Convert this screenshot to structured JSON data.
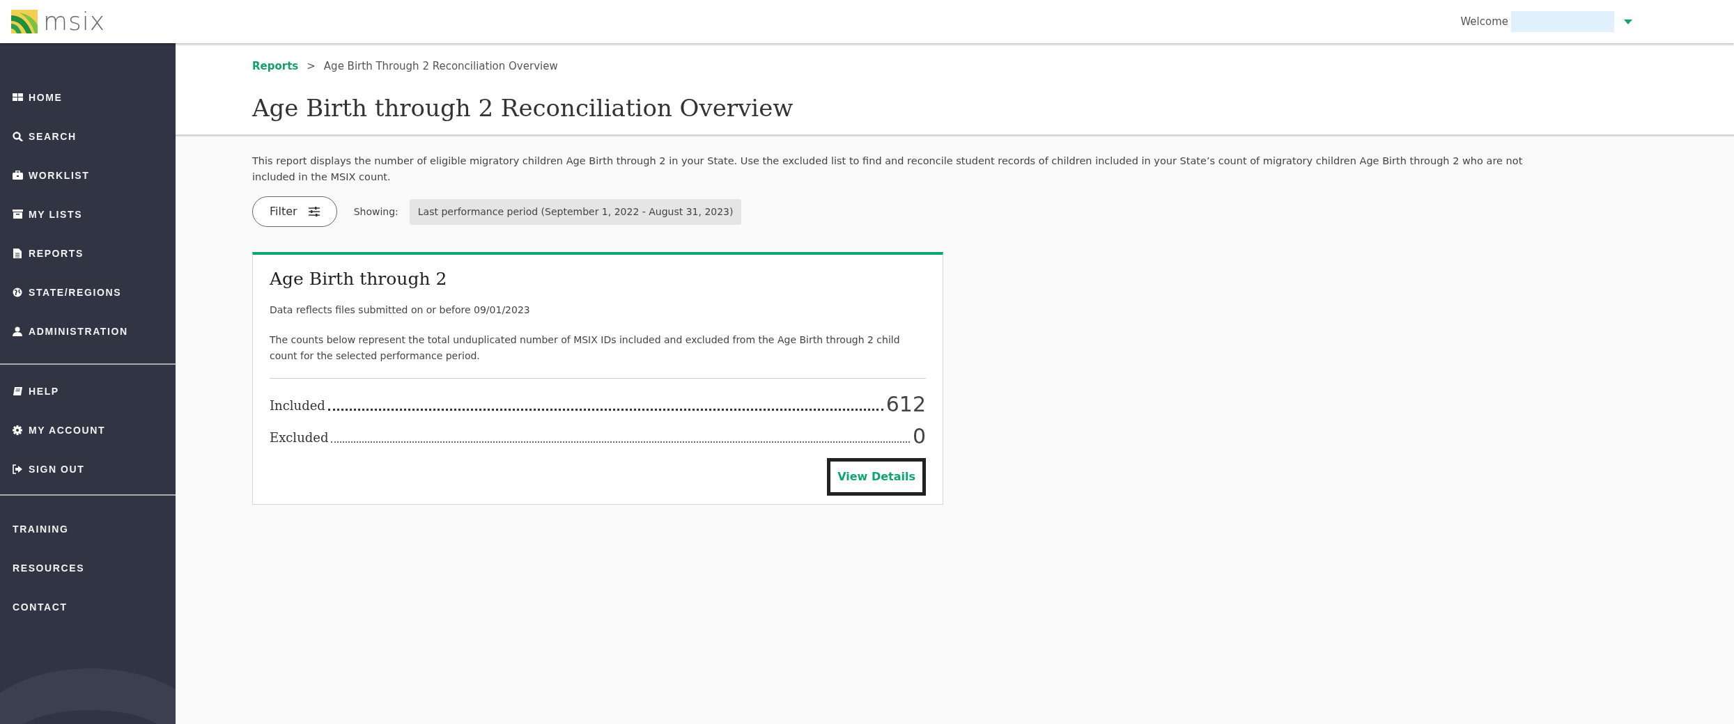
{
  "header": {
    "logo_text": "msix",
    "welcome": "Welcome"
  },
  "sidebar": {
    "main_items": [
      {
        "label": "HOME"
      },
      {
        "label": "SEARCH"
      },
      {
        "label": "WORKLIST"
      },
      {
        "label": "MY LISTS"
      },
      {
        "label": "REPORTS"
      },
      {
        "label": "STATE/REGIONS"
      },
      {
        "label": "ADMINISTRATION"
      }
    ],
    "account_items": [
      {
        "label": "HELP"
      },
      {
        "label": "MY ACCOUNT"
      },
      {
        "label": "SIGN OUT"
      }
    ],
    "extra_items": [
      {
        "label": "TRAINING"
      },
      {
        "label": "RESOURCES"
      },
      {
        "label": "CONTACT"
      }
    ]
  },
  "breadcrumb": {
    "link": "Reports",
    "separator": ">",
    "current": "Age Birth Through 2 Reconciliation Overview"
  },
  "page_title": "Age Birth through 2 Reconciliation Overview",
  "description": "This report displays the number of eligible migratory children Age Birth through 2 in your State. Use the excluded list to find and reconcile student records of children included in your State’s count of migratory children Age Birth through 2 who are not included in the MSIX count.",
  "filter": {
    "button": "Filter",
    "showing_label": "Showing:",
    "showing_value": "Last performance period (September 1, 2022 - August 31, 2023)"
  },
  "card": {
    "title": "Age Birth through 2",
    "note": "Data reflects files submitted on or before 09/01/2023",
    "explanation": "The counts below represent the total unduplicated number of MSIX IDs included and excluded from the Age Birth through 2 child count for the selected performance period.",
    "counts": [
      {
        "label": "Included",
        "value": "612"
      },
      {
        "label": "Excluded",
        "value": "0"
      }
    ],
    "link": {
      "label": "View Details",
      "focused": true
    }
  }
}
